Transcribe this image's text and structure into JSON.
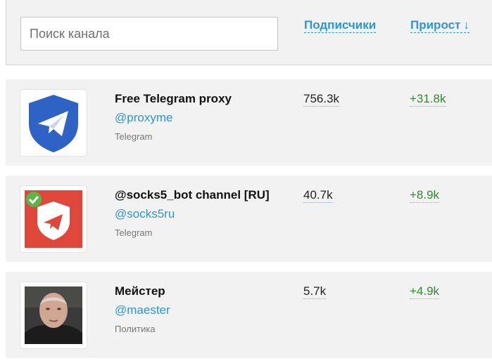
{
  "search": {
    "placeholder": "Поиск канала"
  },
  "columns": {
    "subscribers": "Подписчики",
    "growth": "Прирост",
    "sort_arrow": "↓"
  },
  "channels": [
    {
      "title": "Free Telegram proxy",
      "handle": "@proxyme",
      "category": "Telegram",
      "subscribers": "756.3k",
      "growth": "+31.8k",
      "avatar_icon": "shield-paper-plane-icon"
    },
    {
      "title": "@socks5_bot channel [RU]",
      "handle": "@socks5ru",
      "category": "Telegram",
      "subscribers": "40.7k",
      "growth": "+8.9k",
      "avatar_icon": "verified-shield-icon"
    },
    {
      "title": "Мейстер",
      "handle": "@maester",
      "category": "Политика",
      "subscribers": "5.7k",
      "growth": "+4.9k",
      "avatar_icon": "portrait-photo"
    }
  ],
  "colors": {
    "accent": "#2d95d0",
    "growth": "#2e8b2e",
    "row_bg": "#f2f2f2"
  }
}
